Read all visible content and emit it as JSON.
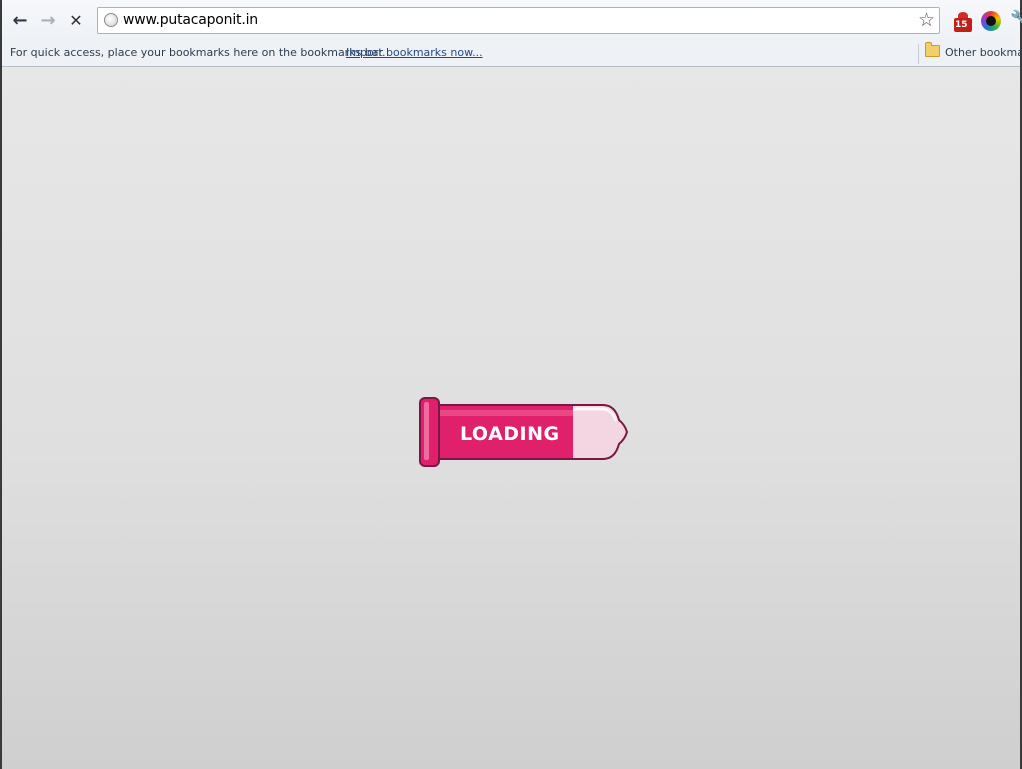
{
  "browser": {
    "url": "www.putacaponit.in",
    "extension_badge": "15"
  },
  "bookmarks_bar": {
    "message": "For quick access, place your bookmarks here on the bookmarks bar.",
    "import_link": "Import bookmarks now...",
    "other_bookmarks": "Other bookmark"
  },
  "page": {
    "loading_label": "LOADING",
    "colors": {
      "accent": "#e0206a",
      "outline": "#7a1746",
      "background": "#dedede"
    }
  }
}
